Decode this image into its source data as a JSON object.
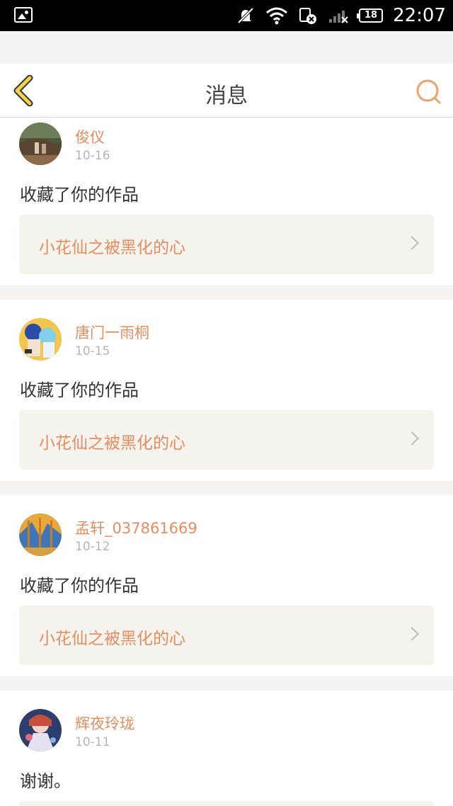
{
  "status_bar": {
    "battery": "18",
    "time": "22:07"
  },
  "header": {
    "title": "消息"
  },
  "messages": [
    {
      "username": "俊仪",
      "date": "10-16",
      "text": "收藏了你的作品",
      "work_title": "小花仙之被黑化的心"
    },
    {
      "username": "唐门一雨桐",
      "date": "10-15",
      "text": "收藏了你的作品",
      "work_title": "小花仙之被黑化的心"
    },
    {
      "username": "孟轩_037861669",
      "date": "10-12",
      "text": "收藏了你的作品",
      "work_title": "小花仙之被黑化的心"
    },
    {
      "username": "辉夜玲珑",
      "date": "10-11",
      "text": "谢谢。",
      "work_title": ""
    }
  ],
  "colors": {
    "accent": "#e98d5d",
    "back_icon": "#f0d54a",
    "card_link_bg": "#f4f3ee",
    "date": "#b5b5b5"
  }
}
